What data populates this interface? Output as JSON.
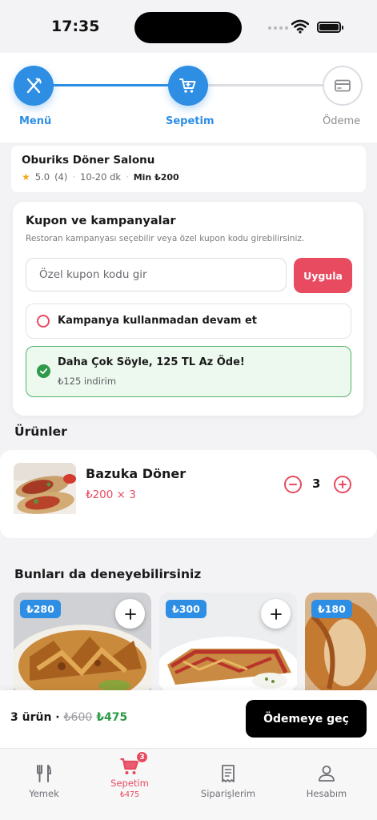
{
  "status": {
    "time": "17:35"
  },
  "stepper": {
    "steps": [
      {
        "label": "Menü",
        "state": "done",
        "icon": "fork-knife-icon"
      },
      {
        "label": "Sepetim",
        "state": "current",
        "icon": "cart-icon"
      },
      {
        "label": "Ödeme",
        "state": "pending",
        "icon": "credit-card-icon"
      }
    ]
  },
  "restaurant": {
    "name": "Oburiks Döner Salonu",
    "rating": "5.0",
    "reviews": "(4)",
    "delivery_time": "10-20 dk",
    "min_order": "Min ₺200"
  },
  "coupon": {
    "title": "Kupon ve kampanyalar",
    "subtitle": "Restoran kampanyası seçebilir veya özel kupon kodu girebilirsiniz.",
    "input_placeholder": "Özel kupon kodu gir",
    "apply_label": "Uygula",
    "options": [
      {
        "label": "Kampanya kullanmadan devam et",
        "selected": false
      },
      {
        "label": "Daha Çok Söyle, 125 TL Az Öde!",
        "sub": "₺125 indirim",
        "selected": true
      }
    ]
  },
  "products": {
    "title": "Ürünler",
    "items": [
      {
        "name": "Bazuka Döner",
        "price_line": "₺200 × 3",
        "quantity": "3"
      }
    ]
  },
  "suggestions": {
    "title": "Bunları da deneyebilirsiniz",
    "items": [
      {
        "price": "₺280"
      },
      {
        "price": "₺300"
      },
      {
        "price": "₺180"
      }
    ]
  },
  "checkout": {
    "count": "3 ürün ·",
    "old_total": "₺600",
    "new_total": "₺475",
    "button": "Ödemeye geç"
  },
  "tabbar": {
    "items": [
      {
        "label": "Yemek",
        "icon": "fork-knife-icon"
      },
      {
        "label": "Sepetim",
        "icon": "cart-icon",
        "badge": "3",
        "sub": "₺475",
        "active": true
      },
      {
        "label": "Siparişlerim",
        "icon": "receipt-icon"
      },
      {
        "label": "Hesabım",
        "icon": "user-icon"
      }
    ]
  },
  "colors": {
    "primary_blue": "#2e8ee3",
    "accent_red": "#e84a5f",
    "success_green": "#2e9a4a"
  }
}
